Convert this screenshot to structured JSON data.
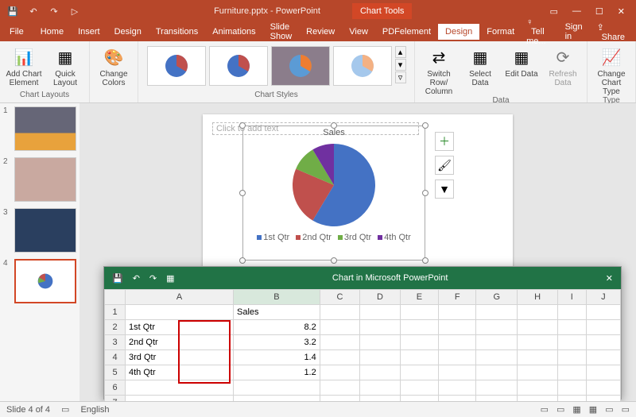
{
  "titlebar": {
    "doc": "Furniture.pptx - PowerPoint",
    "context": "Chart Tools"
  },
  "menu": {
    "tabs": [
      "File",
      "Home",
      "Insert",
      "Design",
      "Transitions",
      "Animations",
      "Slide Show",
      "Review",
      "View",
      "PDFelement",
      "Design",
      "Format"
    ],
    "active": 10,
    "tell": "Tell me...",
    "signin": "Sign in",
    "share": "Share"
  },
  "ribbon": {
    "chartlayouts": {
      "label": "Chart Layouts",
      "add": "Add Chart Element",
      "quick": "Quick Layout"
    },
    "colors": {
      "label": "",
      "btn": "Change Colors"
    },
    "styles": {
      "label": "Chart Styles"
    },
    "data": {
      "label": "Data",
      "switch": "Switch Row/\nColumn",
      "select": "Select Data",
      "edit": "Edit Data",
      "refresh": "Refresh Data"
    },
    "type": {
      "label": "Type",
      "btn": "Change Chart Type"
    }
  },
  "slide": {
    "placeholder": "Click to add text"
  },
  "chart_data": {
    "type": "pie",
    "title": "Sales",
    "categories": [
      "1st Qtr",
      "2nd Qtr",
      "3rd Qtr",
      "4th Qtr"
    ],
    "values": [
      8.2,
      3.2,
      1.4,
      1.2
    ],
    "colors": [
      "#4472c4",
      "#c0504d",
      "#70ad47",
      "#7030a0"
    ],
    "legend": [
      "1st Qtr",
      "2nd Qtr",
      "3rd Qtr",
      "4th Qtr"
    ]
  },
  "excel": {
    "title": "Chart in Microsoft PowerPoint",
    "cols": [
      "",
      "A",
      "B",
      "C",
      "D",
      "E",
      "F",
      "G",
      "H",
      "I",
      "J"
    ],
    "header": "Sales",
    "rows": [
      {
        "n": 2,
        "a": "1st Qtr",
        "b": "8.2"
      },
      {
        "n": 3,
        "a": "2nd Qtr",
        "b": "3.2"
      },
      {
        "n": 4,
        "a": "3rd Qtr",
        "b": "1.4"
      },
      {
        "n": 5,
        "a": "4th Qtr",
        "b": "1.2"
      }
    ]
  },
  "status": {
    "slide": "Slide 4 of 4",
    "lang": "English"
  }
}
